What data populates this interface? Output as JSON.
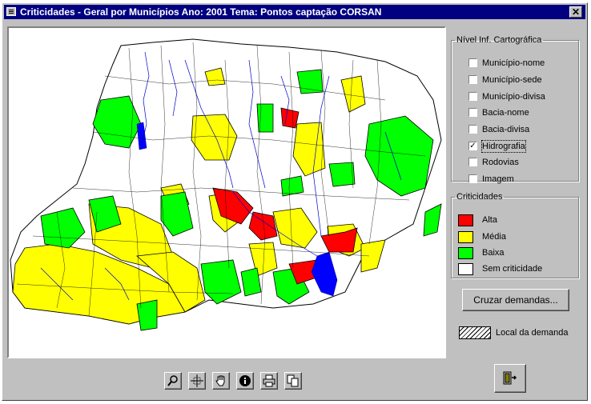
{
  "window": {
    "title": "Criticidades - Geral por Municípios  Ano: 2001  Tema: Pontos captação CORSAN",
    "close_label": "✕"
  },
  "nivel": {
    "legend": "Nível  Inf. Cartográfica",
    "items": [
      {
        "label": "Município-nome",
        "checked": false
      },
      {
        "label": "Município-sede",
        "checked": false
      },
      {
        "label": "Município-divisa",
        "checked": false
      },
      {
        "label": "Bacia-nome",
        "checked": false
      },
      {
        "label": "Bacia-divisa",
        "checked": false
      },
      {
        "label": "Hidrografia",
        "checked": true
      },
      {
        "label": "Rodovias",
        "checked": false
      },
      {
        "label": "Imagem",
        "checked": false
      }
    ]
  },
  "criticidades": {
    "legend": "Criticidades",
    "items": [
      {
        "label": "Alta",
        "color": "#ff0000"
      },
      {
        "label": "Média",
        "color": "#ffff00"
      },
      {
        "label": "Baixa",
        "color": "#00ff00"
      },
      {
        "label": "Sem criticidade",
        "color": "#ffffff"
      }
    ]
  },
  "buttons": {
    "cruzar": "Cruzar demandas..."
  },
  "hatch_legend": "Local da demanda",
  "toolbar": [
    "zoom-icon",
    "pan-extent-icon",
    "hand-icon",
    "info-icon",
    "print-icon",
    "copy-icon"
  ],
  "exit_icon": "exit-door-icon"
}
